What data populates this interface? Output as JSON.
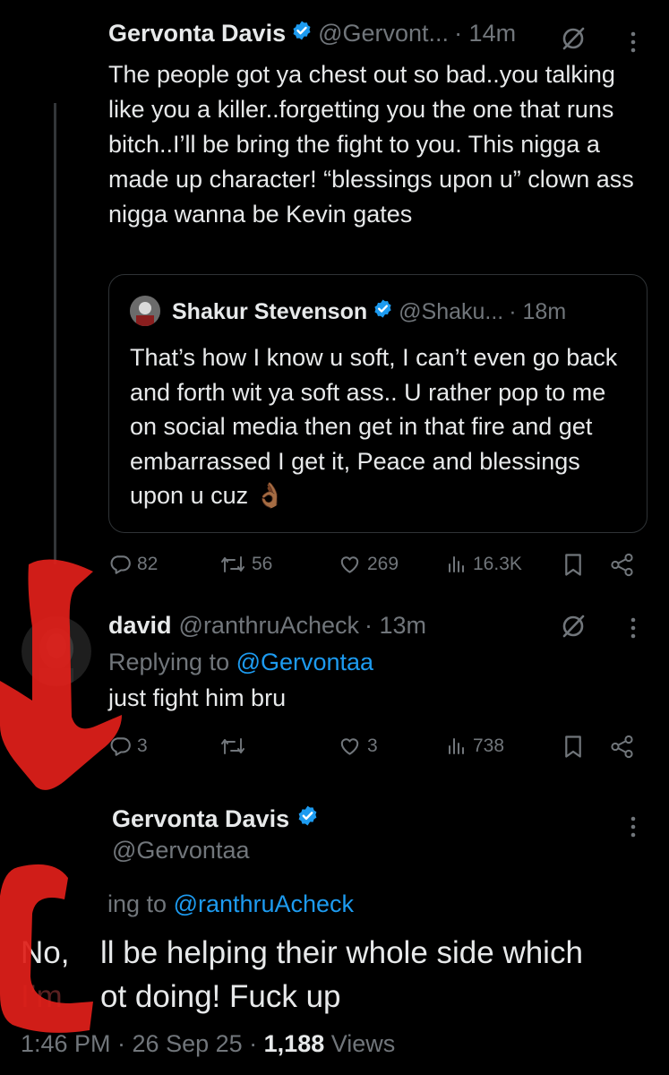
{
  "tweet1": {
    "author_name": "Gervonta Davis",
    "author_handle": "@Gervont...",
    "time": "· 14m",
    "text": "The people got ya chest out so bad..you talking like you a killer..forgetting you the one that runs bitch..I’ll be bring the fight to you. This nigga a made up character! “blessings upon u” clown ass nigga wanna be Kevin gates",
    "quote": {
      "author_name": "Shakur Stevenson",
      "author_handle": "@Shaku...",
      "time": "· 18m",
      "text": "That’s how I know u soft, I can’t even go back and forth wit ya soft ass.. U rather pop to me on social media then get in that fire and get embarrassed I get it, Peace and blessings upon u cuz 👌🏾"
    },
    "replies": "82",
    "reposts": "56",
    "likes": "269",
    "views": "16.3K"
  },
  "tweet2": {
    "author_name": "david",
    "author_handle": "@ranthruAcheck",
    "time": "· 13m",
    "replying_prefix": "Replying to ",
    "replying_to": "@Gervontaa",
    "text": "just fight him bru",
    "replies": "3",
    "likes": "3",
    "views": "738"
  },
  "tweet3": {
    "author_name": "Gervonta Davis",
    "author_handle": "@Gervontaa",
    "replying_visible": "ing to ",
    "replying_to": "@ranthruAcheck",
    "line1_a": "No,",
    "line1_b": "ll be helping their whole side which",
    "line2_a": "I’m",
    "line2_b": "ot doing! Fuck up",
    "timestamp": "1:46 PM · 26 Sep 25 · ",
    "views_count": "1,188",
    "views_label": " Views"
  },
  "colors": {
    "background": "#000000",
    "text": "#e7e9ea",
    "muted": "#71767b",
    "link": "#1d9bf0",
    "verified": "#1d9bf0",
    "annotation": "#e0201a"
  },
  "icons": [
    "verified-badge-icon",
    "grok-icon",
    "more-icon",
    "reply-icon",
    "repost-icon",
    "like-icon",
    "views-icon",
    "bookmark-icon",
    "share-icon"
  ]
}
